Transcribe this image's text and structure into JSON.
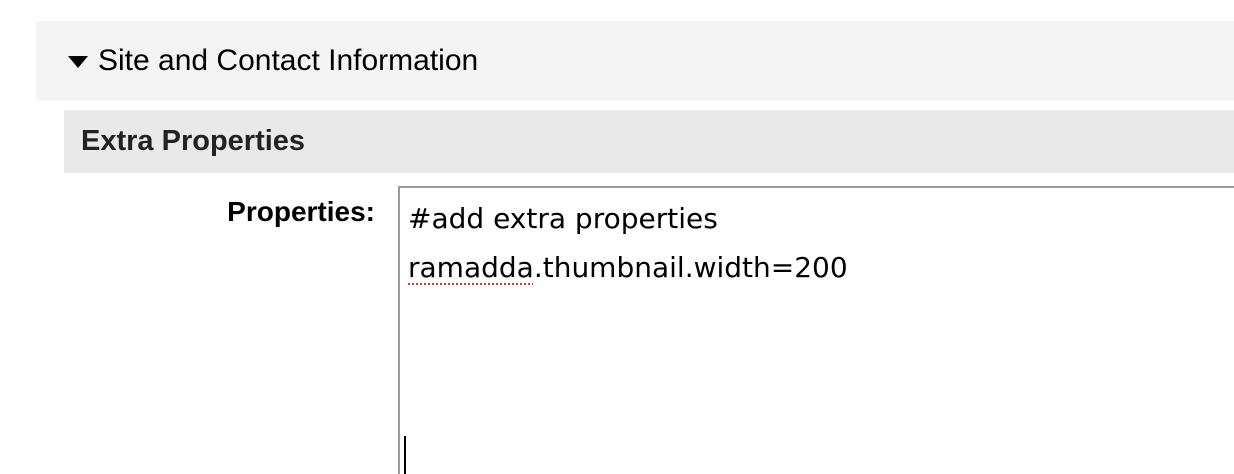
{
  "section": {
    "toggle_icon": "triangle-down-icon",
    "title": "Site and Contact Information"
  },
  "subsection": {
    "title": "Extra Properties"
  },
  "properties_field": {
    "label": "Properties:",
    "lines": [
      {
        "text": "#add extra properties"
      },
      {
        "misspelled": "ramadda",
        "rest": ".thumbnail.width=200"
      }
    ]
  },
  "colors": {
    "section_bg": "#f4f4f4",
    "subsection_bg": "#e9e9e9",
    "spellcheck_underline": "#e03030"
  }
}
